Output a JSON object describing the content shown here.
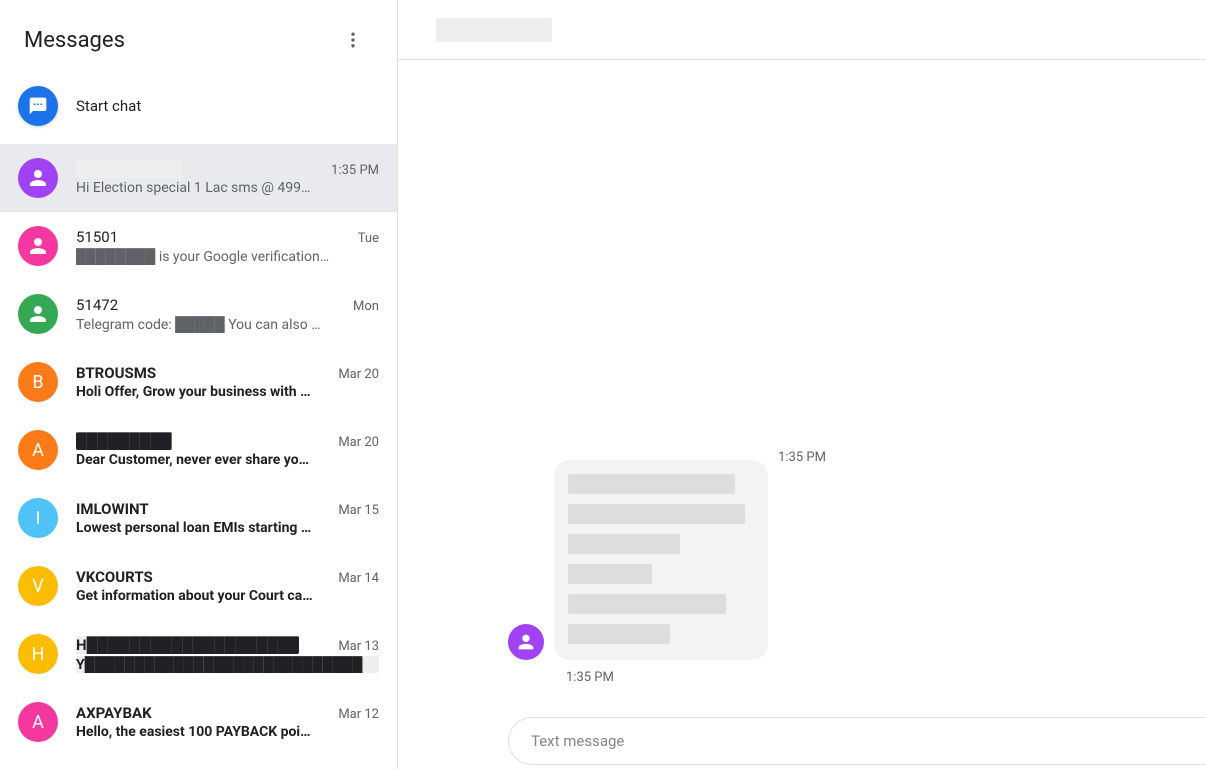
{
  "sidebar": {
    "title": "Messages",
    "start_chat": "Start chat"
  },
  "conversations": [
    {
      "name": "██████████",
      "time": "1:35 PM",
      "preview": "Hi Election special 1 Lac sms @ 499…",
      "avatar_bg": "#a142f4",
      "avatar_type": "person",
      "unread": false,
      "selected": true,
      "name_redacted": true
    },
    {
      "name": "51501",
      "time": "Tue",
      "preview": "████████ is your Google verification…",
      "avatar_bg": "#f538a0",
      "avatar_type": "person",
      "unread": false,
      "selected": false
    },
    {
      "name": "51472",
      "time": "Mon",
      "preview": "Telegram code: █████ You can also …",
      "avatar_bg": "#34a853",
      "avatar_type": "person",
      "unread": false,
      "selected": false
    },
    {
      "name": "BTROUSMS",
      "time": "Mar 20",
      "preview": "Holi Offer, Grow your business with …",
      "avatar_bg": "#fa7b17",
      "avatar_type": "letter",
      "avatar_letter": "B",
      "unread": true,
      "selected": false
    },
    {
      "name": "█████████",
      "time": "Mar 20",
      "preview": "Dear Customer, never ever share yo…",
      "avatar_bg": "#fa7b17",
      "avatar_type": "letter",
      "avatar_letter": "A",
      "unread": true,
      "selected": false,
      "name_redacted": true
    },
    {
      "name": "IMLOWINT",
      "time": "Mar 15",
      "preview": "Lowest personal loan EMIs starting …",
      "avatar_bg": "#4fc3f7",
      "avatar_type": "letter",
      "avatar_letter": "I",
      "unread": true,
      "selected": false
    },
    {
      "name": "VKCOURTS",
      "time": "Mar 14",
      "preview": "Get information about your Court ca…",
      "avatar_bg": "#fbbc04",
      "avatar_type": "letter",
      "avatar_letter": "V",
      "unread": true,
      "selected": false
    },
    {
      "name": "H████████████████████",
      "time": "Mar 13",
      "preview": "Y████████████████████████████",
      "avatar_bg": "#fbbc04",
      "avatar_type": "letter",
      "avatar_letter": "H",
      "unread": true,
      "selected": false,
      "name_redacted": true,
      "preview_redacted": true
    },
    {
      "name": "AXPAYBAK",
      "time": "Mar 12",
      "preview": "Hello, the easiest 100 PAYBACK poi…",
      "avatar_bg": "#f538a0",
      "avatar_type": "letter",
      "avatar_letter": "A",
      "unread": true,
      "selected": false
    }
  ],
  "thread": {
    "header_redacted": true,
    "day_ts": "1:35 PM",
    "message_ts": "1:35 PM"
  },
  "compose": {
    "placeholder": "Text message"
  }
}
